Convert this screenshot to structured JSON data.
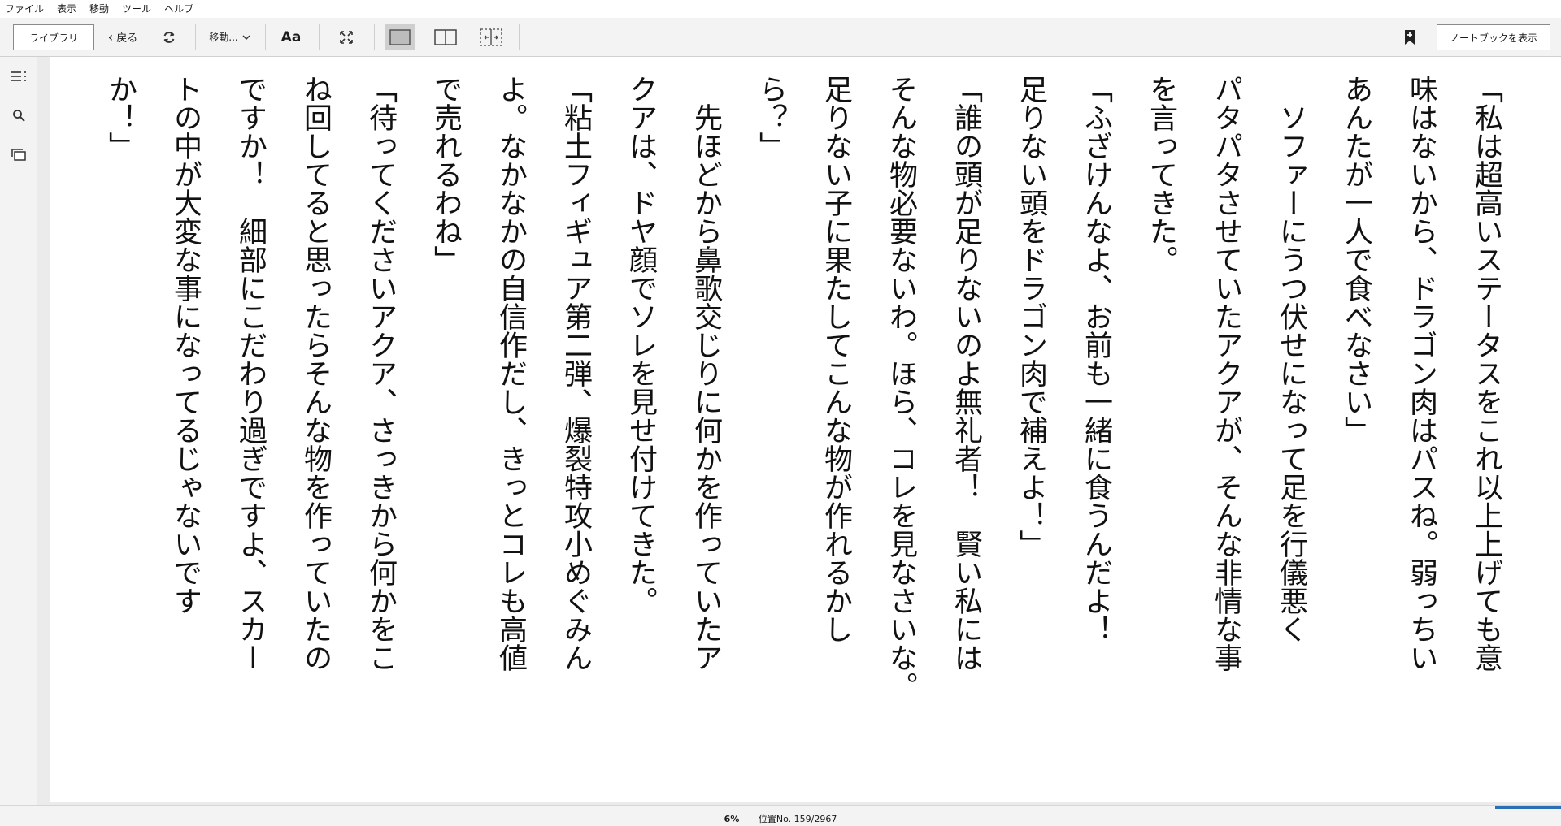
{
  "menu": [
    "ファイル",
    "表示",
    "移動",
    "ツール",
    "ヘルプ"
  ],
  "toolbar": {
    "library_label": "ライブラリ",
    "back_label": "戻る",
    "goto_label": "移動...",
    "font_label": "Aa",
    "notebook_label": "ノートブックを表示"
  },
  "icons": {
    "refresh": "refresh-icon",
    "fullscreen": "fullscreen-icon",
    "single_page": "single-page-icon",
    "two_page": "two-page-icon",
    "scroll_view": "scroll-view-icon",
    "bookmark": "bookmark-icon",
    "toc": "table-of-contents-icon",
    "search": "search-icon",
    "cards": "flashcards-icon"
  },
  "colors": {
    "progress": "#2d6fb5",
    "toolbar_bg": "#f3f3f3"
  },
  "text_columns": [
    "「私は超高いステータスをこれ以上上げても意",
    "味はないから、ドラゴン肉はパスね。弱っちい",
    "あんたが一人で食べなさい」",
    "　ソファーにうつ伏せになって足を行儀悪く",
    "パタパタさせていたアクアが、そんな非情な事",
    "を言ってきた。",
    "「ふざけんなよ、お前も一緒に食うんだよ！",
    "足りない頭をドラゴン肉で補えよ！」",
    "「誰の頭が足りないのよ無礼者！　賢い私には",
    "そんな物必要ないわ。ほら、コレを見なさいな。",
    "足りない子に果たしてこんな物が作れるかし",
    "ら？」",
    "　先ほどから鼻歌交じりに何かを作っていたア",
    "クアは、ドヤ顔でソレを見せ付けてきた。",
    "「粘土フィギュア第二弾、爆裂特攻小めぐみん",
    "よ。なかなかの自信作だし、きっとコレも高値",
    "で売れるわね」",
    "「待ってくださいアクア、さっきから何かをこ",
    "ね回してると思ったらそんな物を作っていたの",
    "ですか！　細部にこだわり過ぎですよ、スカー",
    "トの中が大変な事になってるじゃないです",
    "か！」"
  ],
  "status": {
    "progress_percent": "6%",
    "progress_value": 6,
    "location": "位置No. 159/2967"
  }
}
